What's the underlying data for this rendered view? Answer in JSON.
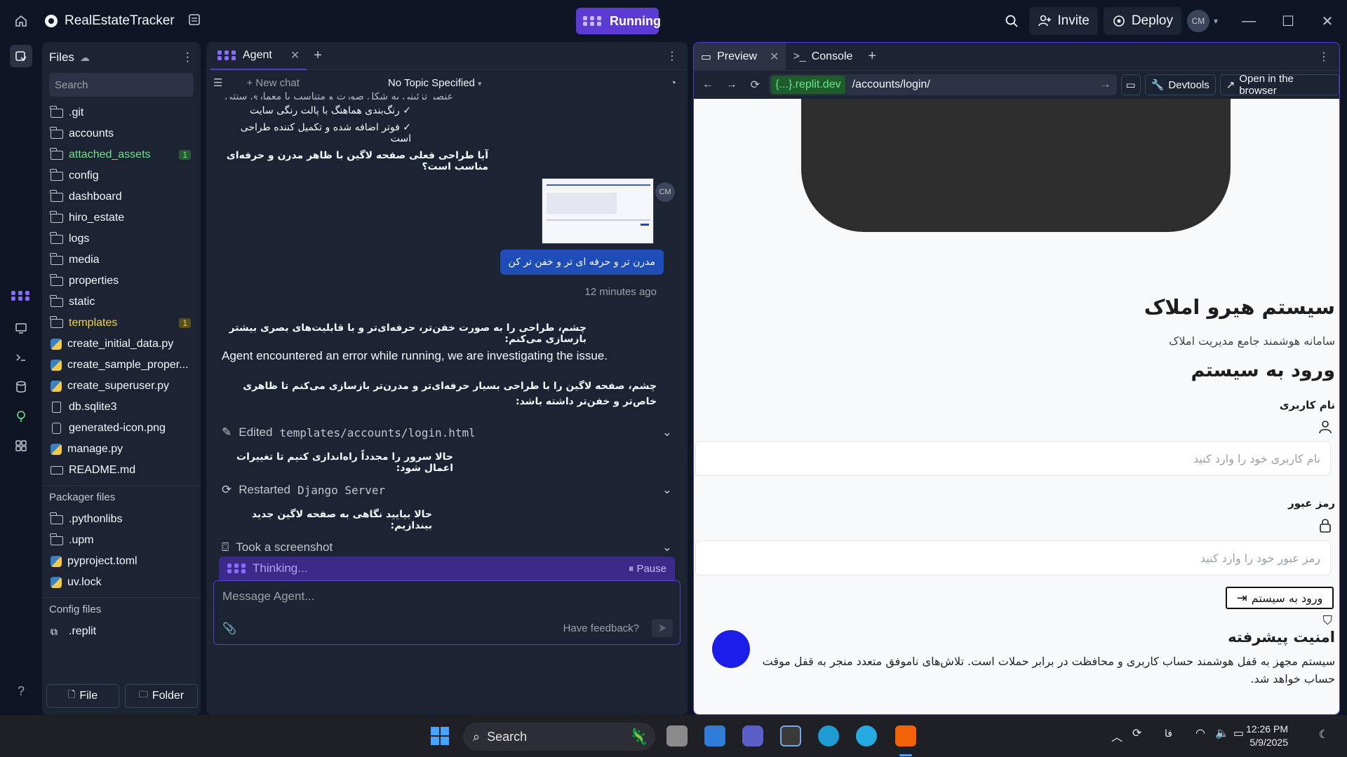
{
  "topbar": {
    "app_name": "RealEstateTracker",
    "running_label": "Running",
    "invite_label": "Invite",
    "deploy_label": "Deploy",
    "avatar_initials": "CM"
  },
  "files": {
    "title": "Files",
    "search_placeholder": "Search",
    "items": [
      {
        "name": ".git",
        "type": "folder"
      },
      {
        "name": "accounts",
        "type": "folder"
      },
      {
        "name": "attached_assets",
        "type": "folder",
        "badge": "1",
        "status": "green"
      },
      {
        "name": "config",
        "type": "folder"
      },
      {
        "name": "dashboard",
        "type": "folder"
      },
      {
        "name": "hiro_estate",
        "type": "folder"
      },
      {
        "name": "logs",
        "type": "folder"
      },
      {
        "name": "media",
        "type": "folder"
      },
      {
        "name": "properties",
        "type": "folder"
      },
      {
        "name": "static",
        "type": "folder"
      },
      {
        "name": "templates",
        "type": "folder",
        "badge": "1",
        "status": "yellow"
      },
      {
        "name": "create_initial_data.py",
        "type": "python"
      },
      {
        "name": "create_sample_proper...",
        "type": "python"
      },
      {
        "name": "create_superuser.py",
        "type": "python"
      },
      {
        "name": "db.sqlite3",
        "type": "file"
      },
      {
        "name": "generated-icon.png",
        "type": "image"
      },
      {
        "name": "manage.py",
        "type": "python"
      },
      {
        "name": "README.md",
        "type": "markdown"
      }
    ],
    "packager_label": "Packager files",
    "packager_items": [
      {
        "name": ".pythonlibs",
        "type": "folder"
      },
      {
        "name": ".upm",
        "type": "folder"
      },
      {
        "name": "pyproject.toml",
        "type": "python"
      },
      {
        "name": "uv.lock",
        "type": "python"
      }
    ],
    "config_label": "Config files",
    "config_items": [
      {
        "name": ".replit",
        "type": "replit"
      }
    ],
    "new_file_label": "File",
    "new_folder_label": "Folder"
  },
  "agent": {
    "tab_label": "Agent",
    "new_chat_label": "New chat",
    "topic_label": "No Topic Specified",
    "messages": {
      "line0": "عنصر تزئینی به شکل صورت و متناسب با معماری سنتی",
      "line1": "✓ رنگ‌بندی هماهنگ با پالت رنگی سایت",
      "line2": "✓ فوتر اضافه شده و تکمیل کننده طراحی است",
      "question": "آیا طراحی فعلی صفحه لاگین با ظاهر مدرن و حرفه‌ای مناسب است؟",
      "user_avatar": "CM",
      "user_message": "مدرن تر و حرفه ای تر و خفن تر کن",
      "timestamp": "12 minutes ago",
      "reply1": "چشم، طراحی را به صورت خفن‌تر، حرفه‌ای‌تر و با قابلیت‌های بصری بیشتر بازسازی می‌کنم:",
      "error": "Agent encountered an error while running, we are investigating the issue.",
      "reply2": "چشم، صفحه لاگین را با طراحی بسیار حرفه‌ای‌تر و مدرن‌تر بازسازی می‌کنم تا ظاهری خاص‌تر و خفن‌تر داشته باشد:",
      "edited_label": "Edited",
      "edited_path": "templates/accounts/login.html",
      "restart_note": "حالا سرور را مجدداً راه‌اندازی کنیم تا تغییرات اعمال شود:",
      "restarted_label": "Restarted",
      "restarted_target": "Django Server",
      "screenshot_note": "حالا بیایید نگاهی به صفحه لاگین جدید بیندازیم:",
      "screenshot_label": "Took a screenshot"
    },
    "thinking_label": "Thinking...",
    "pause_label": "Pause",
    "composer_placeholder": "Message Agent...",
    "feedback_label": "Have feedback?"
  },
  "preview": {
    "tab_preview": "Preview",
    "tab_console": "Console",
    "url_host": "{...}.replit.dev",
    "url_path": "/accounts/login/",
    "devtools_label": "Devtools",
    "open_browser_label": "Open in the browser",
    "page": {
      "title": "سیستم هیرو املاک",
      "subtitle": "سامانه هوشمند جامع مدیریت املاک",
      "login_heading": "ورود به سیستم",
      "username_label": "نام کاربری",
      "username_placeholder": "نام کاربری خود را وارد کنید",
      "password_label": "رمز عبور",
      "password_placeholder": "رمز عبور خود را وارد کنید",
      "login_button": "ورود به سیستم",
      "security_heading": "امنیت پیشرفته",
      "security_text": "سیستم مجهز به قفل هوشمند حساب کاربری و محافظت در برابر حملات است. تلاش‌های ناموفق متعدد منجر به قفل موقت حساب خواهد شد."
    }
  },
  "taskbar": {
    "search_label": "Search",
    "lang": "فا",
    "time": "12:26 PM",
    "date": "5/9/2025"
  },
  "colors": {
    "accent": "#5b3bd4",
    "panel": "#1c2333",
    "background": "#0e1525",
    "user_bubble": "#1e4db7"
  }
}
